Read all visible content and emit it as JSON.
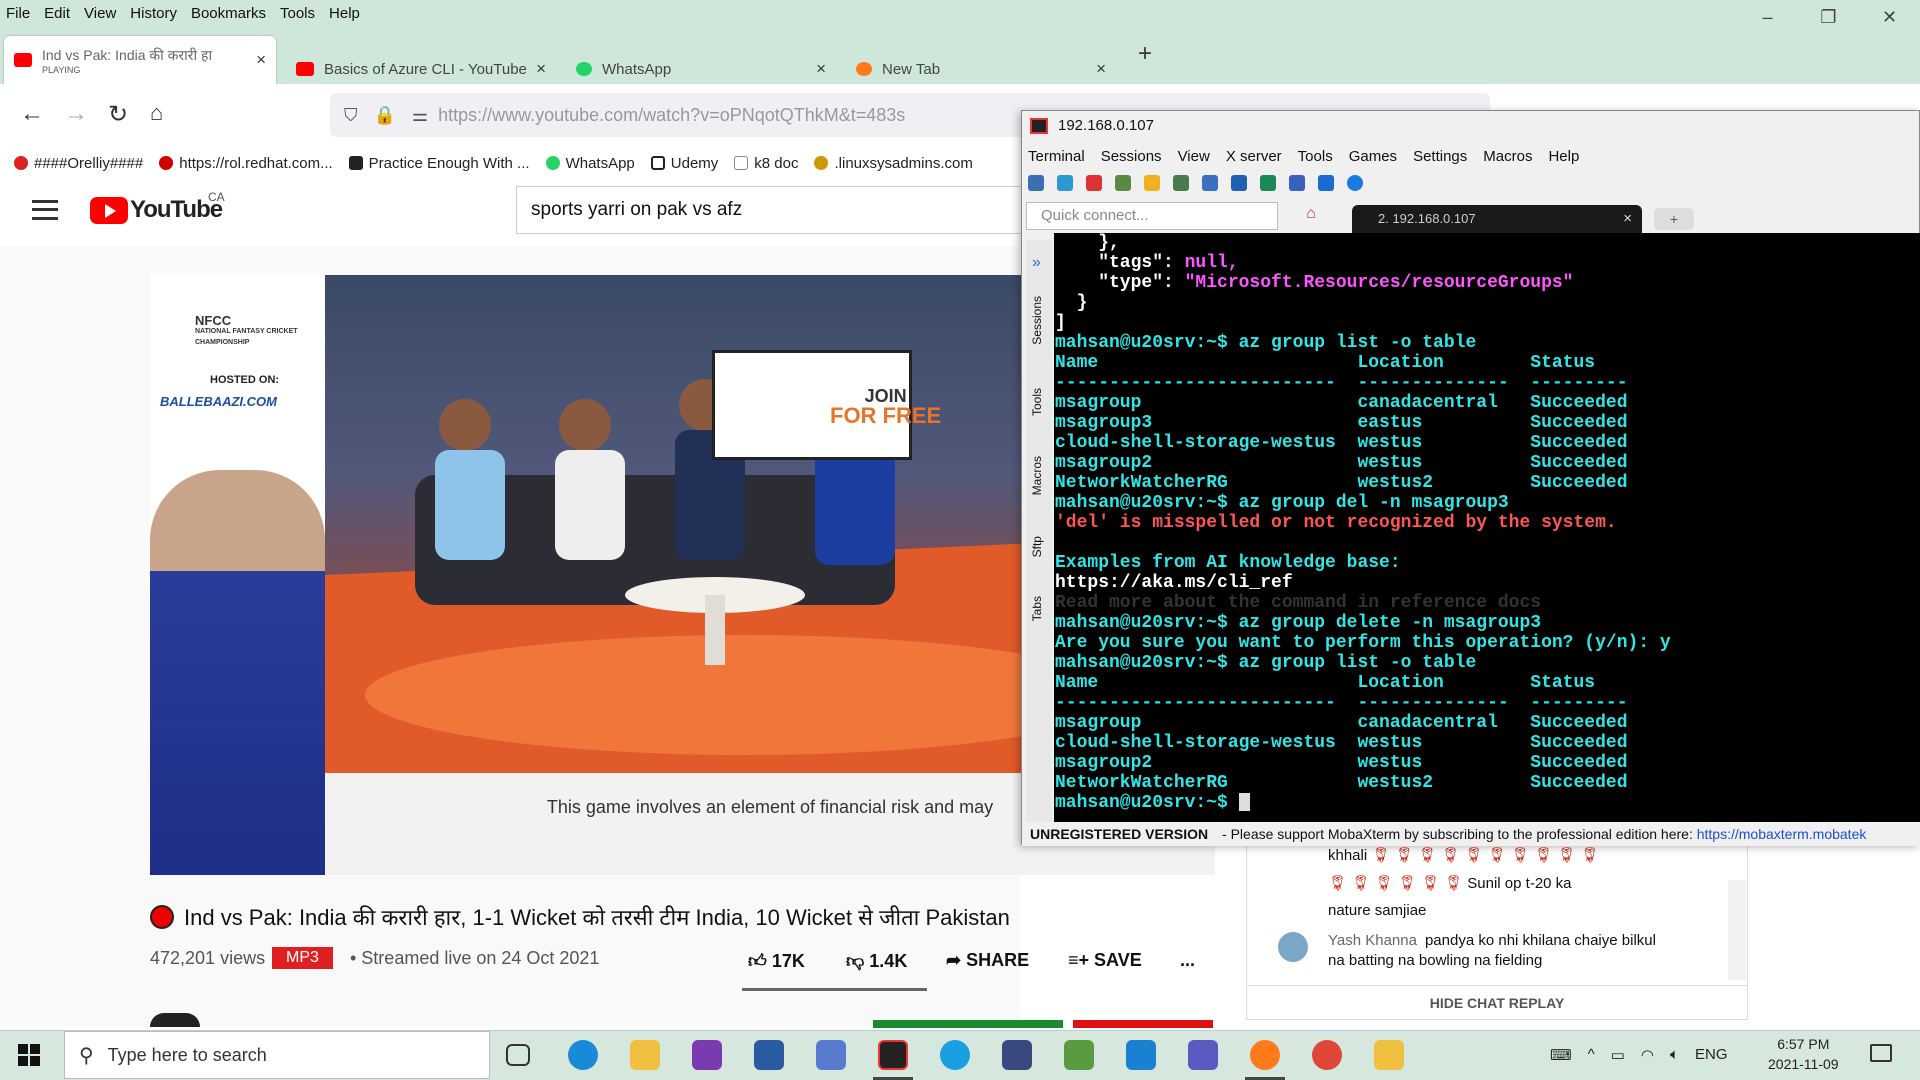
{
  "browser": {
    "menu": [
      "File",
      "Edit",
      "View",
      "History",
      "Bookmarks",
      "Tools",
      "Help"
    ],
    "tabs": [
      {
        "title": "Ind vs Pak: India की करारी हा",
        "sub": "PLAYING",
        "color": "#ff0000"
      },
      {
        "title": "Basics of Azure CLI - YouTube",
        "color": "#ff0000"
      },
      {
        "title": "WhatsApp",
        "color": "#25d366"
      },
      {
        "title": "New Tab",
        "color": "#ff7a1a"
      }
    ],
    "url": "https://www.youtube.com/watch?v=oPNqotQThkM&t=483s",
    "bookmarks": [
      {
        "label": "####Orelliy####",
        "color": "#d22"
      },
      {
        "label": "https://rol.redhat.com...",
        "color": "#c00"
      },
      {
        "label": "Practice Enough With ...",
        "color": "#222"
      },
      {
        "label": "WhatsApp",
        "color": "#25d366"
      },
      {
        "label": "Udemy",
        "color": "#222"
      },
      {
        "label": "k8 doc",
        "color": "#888"
      },
      {
        "label": ".linuxsysadmins.com",
        "color": "#c90"
      }
    ]
  },
  "youtube": {
    "logo": "YouTube",
    "country": "CA",
    "search": "sports yarri on pak vs afz",
    "ad": {
      "nfcc": "NFCC",
      "championship": "NATIONAL FANTASY CRICKET CHAMPIONSHIP",
      "hosted": "HOSTED ON:",
      "brand": "BALLEBAAZI.COM",
      "join": "JOIN",
      "free": "FOR FREE",
      "caption": "This game involves an element of financial risk and may"
    },
    "title": "Ind vs Pak: India की करारी हार, 1-1 Wicket को तरसी टीम India, 10 Wicket से जीता Pakistan",
    "views": "472,201 views",
    "mp3": "MP3",
    "streamed": "• Streamed live on 24 Oct 2021",
    "likes": "17K",
    "dislikes": "1.4K",
    "share": "SHARE",
    "save": "SAVE",
    "more": "...",
    "chat": {
      "line1": "khhali",
      "line2_text": "Sunil op t-20 ka",
      "line3": "nature samjiae",
      "author": "Yash Khanna",
      "msg1": "pandya ko nhi khilana chaiye bilkul",
      "msg2": "na batting na bowling na fielding",
      "hide": "HIDE CHAT REPLAY"
    }
  },
  "mobaxterm": {
    "title": "192.168.0.107",
    "menu": [
      "Terminal",
      "Sessions",
      "View",
      "X server",
      "Tools",
      "Games",
      "Settings",
      "Macros",
      "Help"
    ],
    "quick_placeholder": "Quick connect...",
    "tab": "2. 192.168.0.107",
    "side_tabs": [
      "Sessions",
      "Tools",
      "Macros",
      "Sftp",
      "Tabs"
    ],
    "terminal": [
      {
        "t": "    },",
        "c": "w"
      },
      {
        "t": "    \"tags\": ",
        "c": "w",
        "t2": "null,",
        "c2": "m"
      },
      {
        "t": "    \"type\": ",
        "c": "w",
        "t2": "\"Microsoft.Resources/resourceGroups\"",
        "c2": "m"
      },
      {
        "t": "  }",
        "c": "w"
      },
      {
        "t": "]",
        "c": "w"
      },
      {
        "t": "mahsan@u20srv:~$ az group list -o table",
        "c": "g"
      },
      {
        "t": "Name                        Location        Status",
        "c": "g"
      },
      {
        "t": "--------------------------  --------------  ---------",
        "c": "g"
      },
      {
        "t": "msagroup                    canadacentral   Succeeded",
        "c": "g"
      },
      {
        "t": "msagroup3                   eastus          Succeeded",
        "c": "g"
      },
      {
        "t": "cloud-shell-storage-westus  westus          Succeeded",
        "c": "g"
      },
      {
        "t": "msagroup2                   westus          Succeeded",
        "c": "g"
      },
      {
        "t": "NetworkWatcherRG            westus2         Succeeded",
        "c": "g"
      },
      {
        "t": "mahsan@u20srv:~$ az group del -n msagroup3",
        "c": "g"
      },
      {
        "t": "'del' is misspelled or not recognized by the system.",
        "c": "r"
      },
      {
        "t": "",
        "c": "w"
      },
      {
        "t": "Examples from AI knowledge base:",
        "c": "g"
      },
      {
        "t": "https://aka.ms/cli_ref",
        "c": "w"
      },
      {
        "t": "Read more about the command in reference docs",
        "c": "d"
      },
      {
        "t": "mahsan@u20srv:~$ az group delete -n msagroup3",
        "c": "g"
      },
      {
        "t": "Are you sure you want to perform this operation? (y/n): y",
        "c": "g"
      },
      {
        "t": "mahsan@u20srv:~$ az group list -o table",
        "c": "g"
      },
      {
        "t": "Name                        Location        Status",
        "c": "g"
      },
      {
        "t": "--------------------------  --------------  ---------",
        "c": "g"
      },
      {
        "t": "msagroup                    canadacentral   Succeeded",
        "c": "g"
      },
      {
        "t": "cloud-shell-storage-westus  westus          Succeeded",
        "c": "g"
      },
      {
        "t": "msagroup2                   westus          Succeeded",
        "c": "g"
      },
      {
        "t": "NetworkWatcherRG            westus2         Succeeded",
        "c": "g"
      },
      {
        "t": "mahsan@u20srv:~$ ",
        "c": "g"
      }
    ],
    "status_bold": "UNREGISTERED VERSION",
    "status_text": " -  Please support MobaXterm by subscribing to the professional edition here:  ",
    "status_link": "https://mobaxterm.mobatek"
  },
  "taskbar": {
    "search": "Type here to search",
    "lang": "ENG",
    "time": "6:57 PM",
    "date": "2021-11-09"
  }
}
